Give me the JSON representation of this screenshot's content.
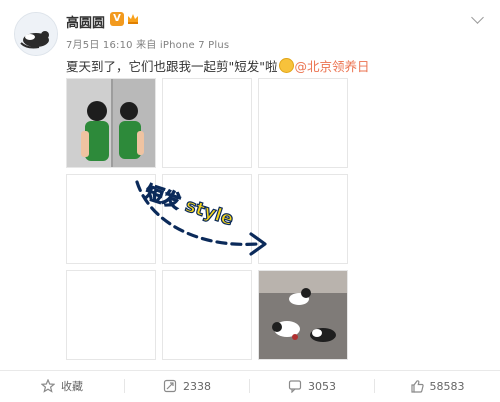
{
  "post": {
    "author": "高圆圆",
    "vip_badge": "V",
    "meta": "7月5日 16:10 来自 iPhone 7 Plus",
    "text_before": "夏天到了，它们也跟我一起剪\"短发\"啦",
    "mention": "@北京领养日",
    "overlay_text": "短发 style"
  },
  "actions": {
    "favorite": "收藏",
    "repost": "2338",
    "comment": "3053",
    "like": "58583"
  },
  "colors": {
    "mention": "#eb7350",
    "vip": "#f29a1f",
    "overlay_fill": "#f6d51c",
    "overlay_stroke": "#0b2a5a"
  }
}
